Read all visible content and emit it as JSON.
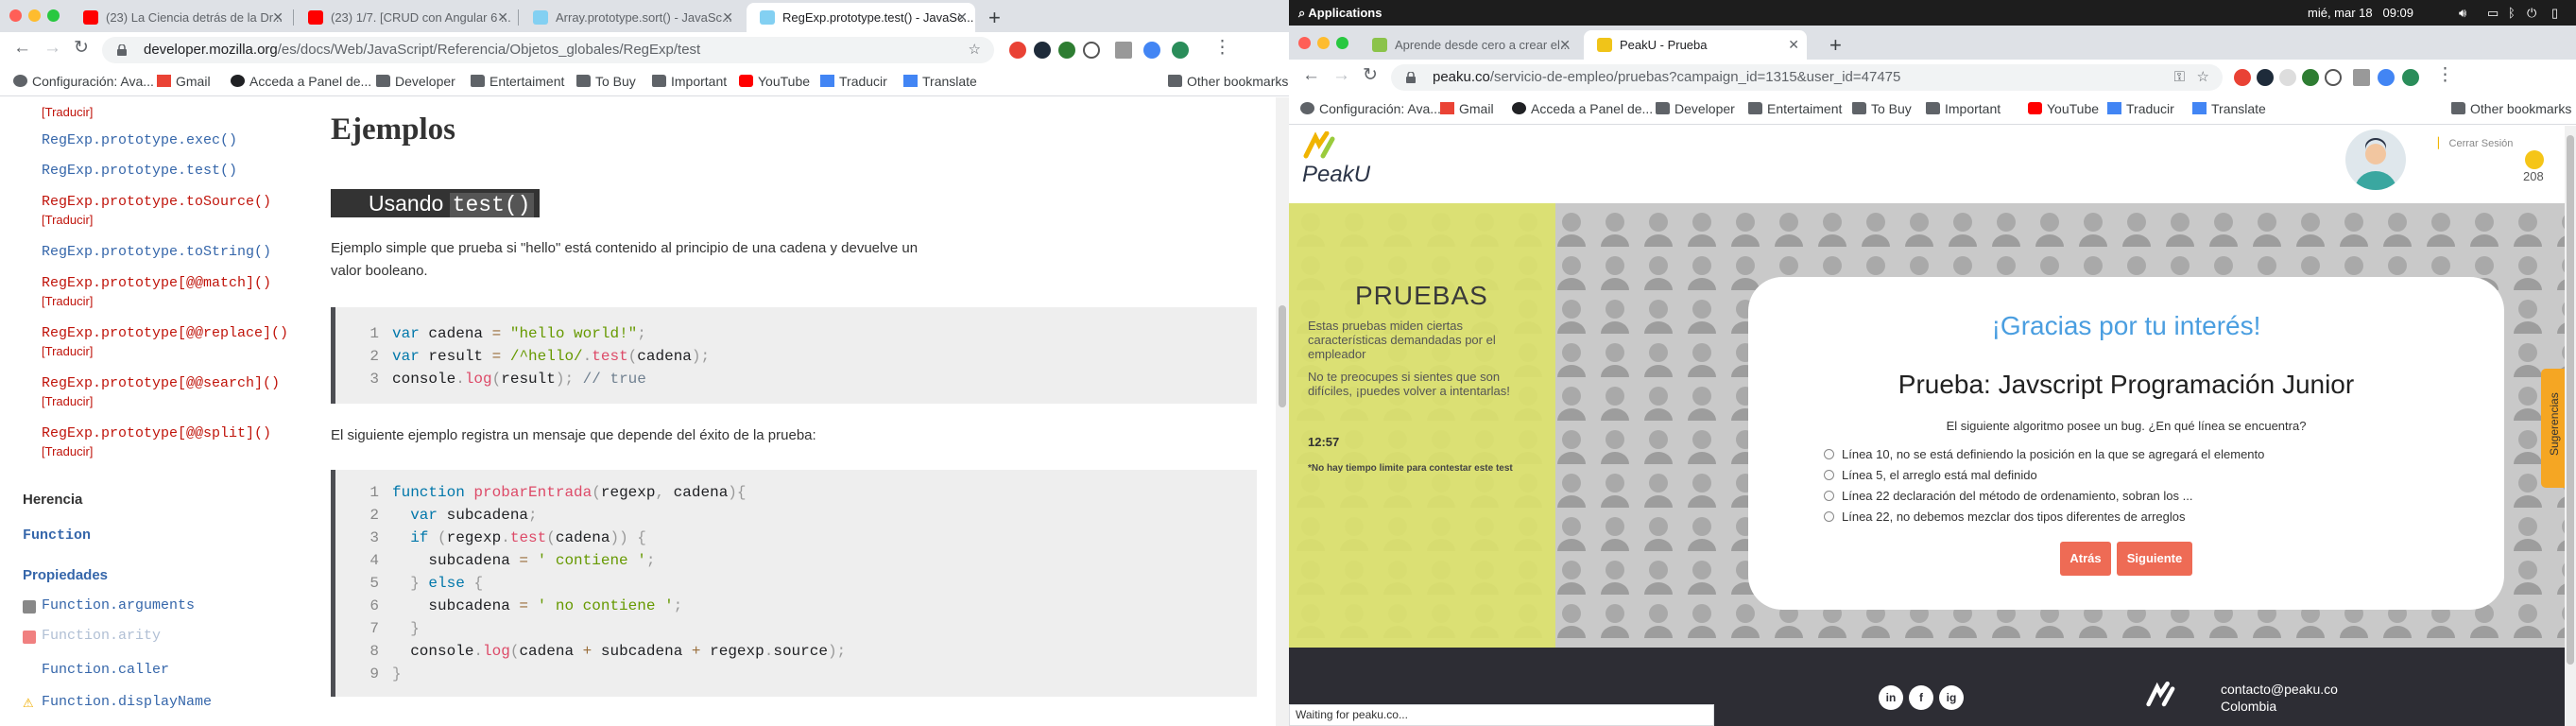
{
  "left": {
    "tabs": [
      {
        "label": "(23) La Ciencia detrás de la Dr..."
      },
      {
        "label": "(23) 1/7. [CRUD con Angular 6 ..."
      },
      {
        "label": "Array.prototype.sort() - JavaSc..."
      },
      {
        "label": "RegExp.prototype.test() - JavaSc..."
      }
    ],
    "url_host": "developer.mozilla.org",
    "url_path": "/es/docs/Web/JavaScript/Referencia/Objetos_globales/RegExp/test",
    "bookmarks": [
      "Configuración: Ava...",
      "Gmail",
      "Acceda a Panel de...",
      "Developer",
      "Entertaiment",
      "To Buy",
      "Important",
      "YouTube",
      "Traducir",
      "Translate",
      "Other bookmarks"
    ],
    "sidebar": {
      "items": [
        {
          "label": "[Traducir]",
          "kind": "trad"
        },
        {
          "label": "RegExp.prototype.exec()",
          "kind": "blue"
        },
        {
          "label": "RegExp.prototype.test()",
          "kind": "blue"
        },
        {
          "label": "RegExp.prototype.toSource()",
          "kind": "red"
        },
        {
          "label": "[Traducir]",
          "kind": "trad"
        },
        {
          "label": "RegExp.prototype.toString()",
          "kind": "blue"
        },
        {
          "label": "RegExp.prototype[@@match]()",
          "kind": "red"
        },
        {
          "label": "[Traducir]",
          "kind": "trad"
        },
        {
          "label": "RegExp.prototype[@@replace]()",
          "kind": "red"
        },
        {
          "label": "[Traducir]",
          "kind": "trad"
        },
        {
          "label": "RegExp.prototype[@@search]()",
          "kind": "red"
        },
        {
          "label": "[Traducir]",
          "kind": "trad"
        },
        {
          "label": "RegExp.prototype[@@split]()",
          "kind": "red"
        },
        {
          "label": "[Traducir]",
          "kind": "trad"
        }
      ],
      "herencia": "Herencia",
      "function": "Function",
      "propiedades": "Propiedades",
      "props": [
        "Function.arguments",
        "Function.arity",
        "Function.caller",
        "Function.displayName"
      ]
    },
    "main": {
      "heading": "Ejemplos",
      "subheading_text": "Usando",
      "subheading_code": "test()",
      "para1": "Ejemplo simple que prueba si \"hello\" está contenido al principio de una cadena y devuelve un",
      "para1b": "valor booleano.",
      "code1": [
        {
          "n": "1",
          "t": "var cadena = \"hello world!\";"
        },
        {
          "n": "2",
          "t": "var result = /^hello/.test(cadena);"
        },
        {
          "n": "3",
          "t": "console.log(result); // true"
        }
      ],
      "para2": "El siguiente ejemplo registra un mensaje que depende del éxito de la prueba:",
      "code2": [
        {
          "n": "1",
          "t": "function probarEntrada(regexp, cadena){"
        },
        {
          "n": "2",
          "t": "  var subcadena;"
        },
        {
          "n": "3",
          "t": "  if (regexp.test(cadena)) {"
        },
        {
          "n": "4",
          "t": "    subcadena = ' contiene ';"
        },
        {
          "n": "5",
          "t": "  } else {"
        },
        {
          "n": "6",
          "t": "    subcadena = ' no contiene ';"
        },
        {
          "n": "7",
          "t": "  }"
        },
        {
          "n": "8",
          "t": "  console.log(cadena + subcadena + regexp.source);"
        },
        {
          "n": "9",
          "t": "}"
        }
      ]
    }
  },
  "right": {
    "system": {
      "applications": "Applications",
      "datetime": "mié, mar 18",
      "time": "09:09"
    },
    "tabs": [
      {
        "label": "Aprende desde cero a crear el..."
      },
      {
        "label": "PeakU - Prueba"
      }
    ],
    "url_host": "peaku.co",
    "url_path": "/servicio-de-empleo/pruebas?campaign_id=1315&user_id=47475",
    "bookmarks": [
      "Configuración: Ava...",
      "Gmail",
      "Acceda a Panel de...",
      "Developer",
      "Entertaiment",
      "To Buy",
      "Important",
      "YouTube",
      "Traducir",
      "Translate",
      "Other bookmarks"
    ],
    "header": {
      "brand": "PeakU",
      "logout": "Cerrar Sesión",
      "coins": "208"
    },
    "yellow": {
      "title": "PRUEBAS",
      "desc1": "Estas pruebas miden ciertas características demandadas por el empleador",
      "desc2": "No te preocupes si sientes que son difíciles, ¡puedes volver a intentarlas!",
      "timer": "12:57",
      "nolimit": "*No hay tiempo limite para contestar este test"
    },
    "card": {
      "thanks": "¡Gracias por tu interés!",
      "title": "Prueba: Javscript Programación Junior",
      "question": "El siguiente algoritmo posee un bug. ¿En qué línea se encuentra?",
      "options": [
        "Línea 10, no se está definiendo la posición en la que se agregará el elemento",
        "Línea 5, el arreglo está mal definido",
        "Línea 22 declaración del método de ordenamiento, sobran los ...",
        "Línea 22, no debemos mezclar dos tipos diferentes de arreglos"
      ],
      "back": "Atrás",
      "next": "Siguiente"
    },
    "footer": {
      "email": "contacto@peaku.co",
      "country": "Colombia",
      "social": [
        "in",
        "f",
        "ig"
      ]
    },
    "status": "Waiting for peaku.co...",
    "suggestions": "Sugerencias"
  }
}
